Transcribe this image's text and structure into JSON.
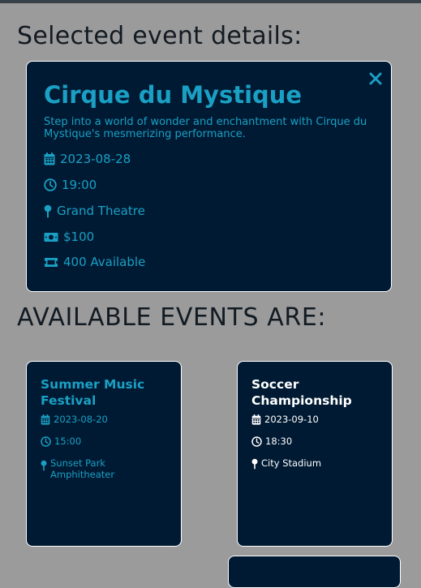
{
  "headings": {
    "selected": "Selected event details:",
    "available": "AVAILABLE EVENTS ARE:"
  },
  "colors": {
    "background": "#9b9b9b",
    "card": "#001a33",
    "accent": "#1aa0c4",
    "card_border": "#ffffff"
  },
  "selected_event": {
    "title": "Cirque du Mystique",
    "description": "Step into a world of wonder and enchantment with Cirque du Mystique's mesmerizing performance.",
    "date": "2023-08-28",
    "time": "19:00",
    "venue": "Grand Theatre",
    "price": "$100",
    "availability": "400 Available",
    "close_icon": "close-icon"
  },
  "events": [
    {
      "title": "Summer Music Festival",
      "date": "2023-08-20",
      "time": "15:00",
      "venue": "Sunset Park Amphitheater"
    },
    {
      "title": "Soccer Championship",
      "date": "2023-09-10",
      "time": "18:30",
      "venue": "City Stadium"
    }
  ],
  "icons": [
    "calendar-icon",
    "clock-icon",
    "map-pin-icon",
    "money-bill-icon",
    "ticket-icon"
  ]
}
